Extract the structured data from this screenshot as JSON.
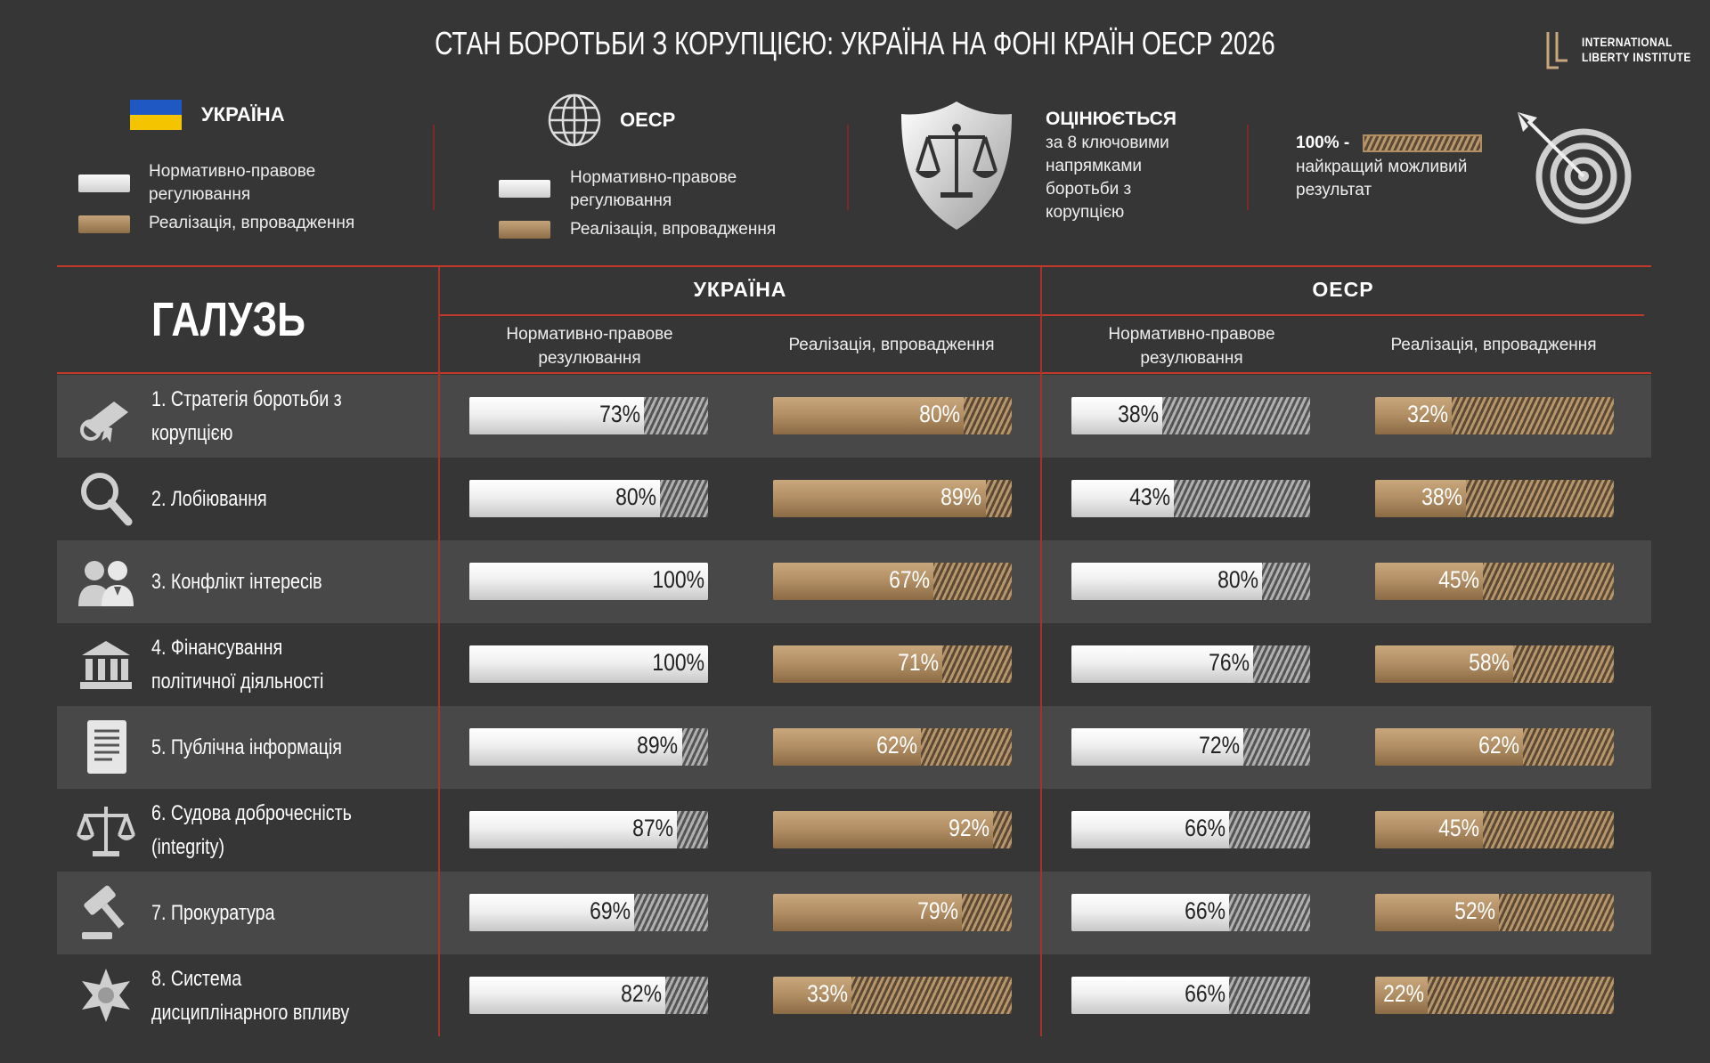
{
  "title": "СТАН БОРОТЬБИ З КОРУПЦІЄЮ: УКРАЇНА НА ФОНІ КРАЇН ОЕСР 2026",
  "logo": {
    "line1": "INTERNATIONAL",
    "line2": "LIBERTY INSTITUTE"
  },
  "legend": {
    "ukraine": {
      "title": "УКРАЇНА",
      "regulation": "Нормативно-правове регулювання",
      "implementation": "Реалізація, впровадження"
    },
    "oecd": {
      "title": "ОЕСР",
      "regulation": "Нормативно-правове регулювання",
      "implementation": "Реалізація, впровадження"
    },
    "assessed": {
      "title": "ОЦІНЮЄТЬСЯ",
      "text": "за 8 ключовими напрямками боротьби з корупцією"
    },
    "best": {
      "label": "100% -",
      "text": "найкращий можливий результат"
    }
  },
  "table": {
    "area_header": "ГАЛУЗЬ",
    "ukraine_header": "УКРАЇНА",
    "oecd_header": "ОЕСР",
    "col_regulation": "Нормативно-правове резулювання",
    "col_implementation": "Реалізація, впровадження"
  },
  "colors": {
    "background": "#363636",
    "accent_red": "#c0392b",
    "gold": "#b08d63",
    "white_bar": "#eeeeee"
  },
  "chart_data": {
    "type": "bar",
    "orientation": "horizontal",
    "unit": "%",
    "xlim": [
      0,
      100
    ],
    "categories": [
      "1. Стратегія боротьби з корупцією",
      "2. Лобіювання",
      "3. Конфлікт інтересів",
      "4. Фінансування політичної діяльності",
      "5. Публічна інформація",
      "6. Судова доброчесність (integrity)",
      "7. Прокуратура",
      "8. Система дисциплінарного впливу"
    ],
    "icons": [
      "diploma-icon",
      "magnifier-icon",
      "people-icon",
      "building-icon",
      "document-icon",
      "scales-icon",
      "gavel-icon",
      "star-badge-icon"
    ],
    "series": [
      {
        "name": "УКРАЇНА — Нормативно-правове резулювання",
        "values": [
          73,
          80,
          100,
          100,
          89,
          87,
          69,
          82
        ]
      },
      {
        "name": "УКРАЇНА — Реалізація, впровадження",
        "values": [
          80,
          89,
          67,
          71,
          62,
          92,
          79,
          33
        ]
      },
      {
        "name": "ОЕСР — Нормативно-правове резулювання",
        "values": [
          38,
          43,
          80,
          76,
          72,
          66,
          66,
          66
        ]
      },
      {
        "name": "ОЕСР — Реалізація, впровадження",
        "values": [
          32,
          38,
          45,
          58,
          62,
          45,
          52,
          22
        ]
      }
    ]
  }
}
